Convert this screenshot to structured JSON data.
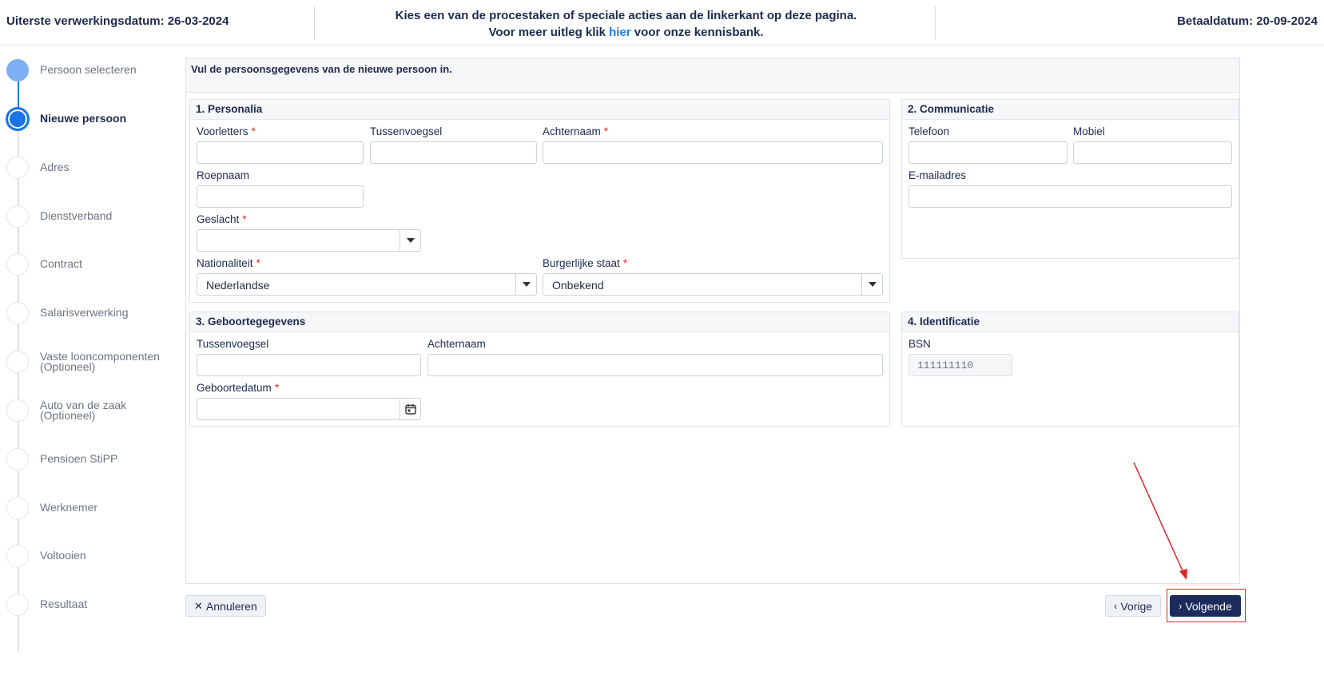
{
  "header": {
    "deadline": "Uiterste verwerkingsdatum: 26-03-2024",
    "instruction_line1": "Kies een van de procestaken of speciale acties aan de linkerkant op deze pagina.",
    "instruction_pre": "Voor meer uitleg klik ",
    "instruction_link": "hier",
    "instruction_post": " voor onze kennisbank.",
    "paydate": "Betaaldatum: 20-09-2024"
  },
  "steps": [
    {
      "label": "Persoon selecteren",
      "state": "past"
    },
    {
      "label": "Nieuwe persoon",
      "state": "active"
    },
    {
      "label": "Adres",
      "state": "todo"
    },
    {
      "label": "Dienstverband",
      "state": "todo"
    },
    {
      "label": "Contract",
      "state": "todo"
    },
    {
      "label": "Salarisverwerking",
      "state": "todo"
    },
    {
      "label": "Vaste looncomponenten (Optioneel)",
      "state": "todo"
    },
    {
      "label": "Auto van de zaak (Optioneel)",
      "state": "todo"
    },
    {
      "label": "Pensioen StiPP",
      "state": "todo"
    },
    {
      "label": "Werknemer",
      "state": "todo"
    },
    {
      "label": "Voltooien",
      "state": "todo"
    },
    {
      "label": "Resultaat",
      "state": "todo"
    }
  ],
  "intro": "Vul de persoonsgegevens van de nieuwe persoon in.",
  "required_mark": "*",
  "personalia": {
    "title": "1. Personalia",
    "voorletters": "Voorletters",
    "tussenvoegsel": "Tussenvoegsel",
    "achternaam": "Achternaam",
    "roepnaam": "Roepnaam",
    "geslacht": "Geslacht",
    "geslacht_value": "",
    "nationaliteit": "Nationaliteit",
    "nationaliteit_value": "Nederlandse",
    "burgerlijke_staat": "Burgerlijke staat",
    "burgerlijke_staat_value": "Onbekend"
  },
  "communicatie": {
    "title": "2. Communicatie",
    "telefoon": "Telefoon",
    "mobiel": "Mobiel",
    "email": "E-mailadres"
  },
  "geboorte": {
    "title": "3. Geboortegegevens",
    "tussenvoegsel": "Tussenvoegsel",
    "achternaam": "Achternaam",
    "geboortedatum": "Geboortedatum"
  },
  "identificatie": {
    "title": "4. Identificatie",
    "bsn": "BSN",
    "bsn_value": "111111110"
  },
  "buttons": {
    "cancel": "Annuleren",
    "previous": "Vorige",
    "next": "Volgende"
  },
  "colors": {
    "accent": "#1b74e8",
    "primary_button": "#1d2a5c",
    "required": "#e02424",
    "annotation": "#e02424"
  }
}
